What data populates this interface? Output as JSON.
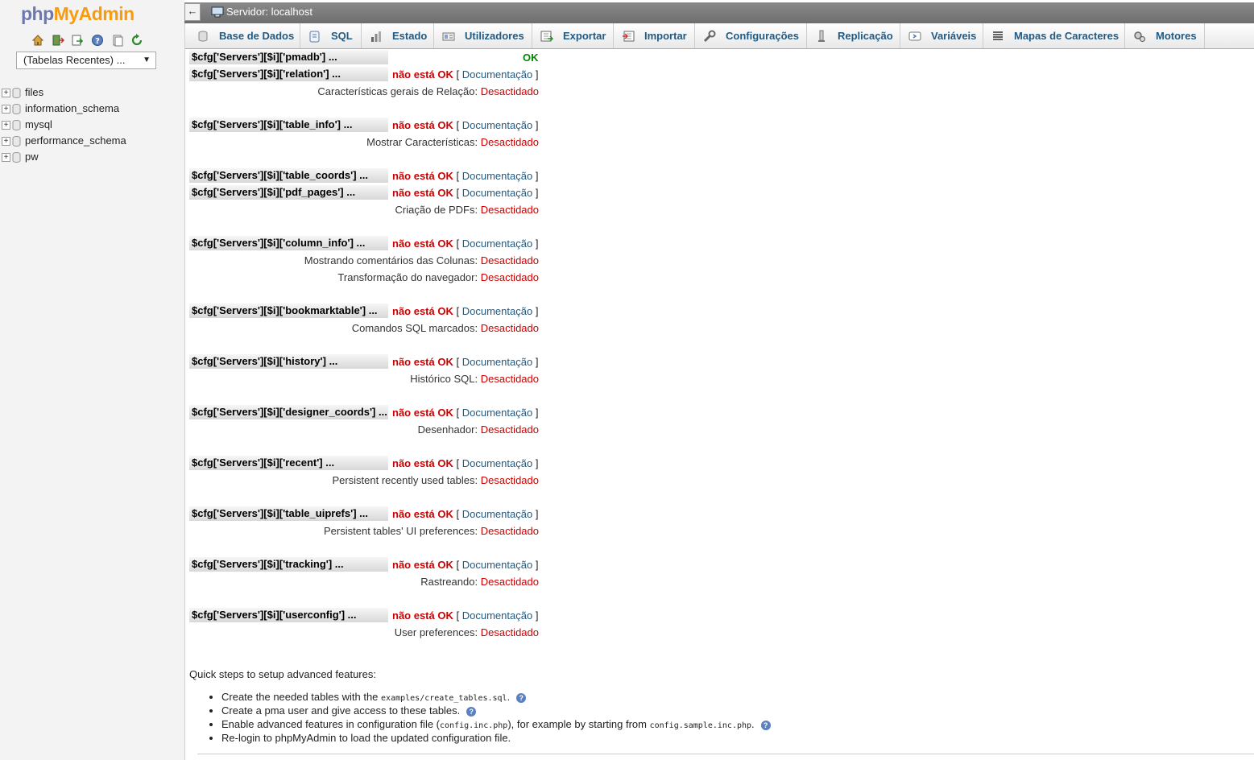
{
  "sidebar": {
    "logo_php": "php",
    "logo_myadmin": "MyAdmin",
    "quick_icons": [
      "home-icon",
      "logout-icon",
      "sql-query-icon",
      "help-icon",
      "documentation-icon",
      "reload-icon"
    ],
    "recent_tables": "(Tabelas Recentes) ...",
    "databases": [
      "files",
      "information_schema",
      "mysql",
      "performance_schema",
      "pw"
    ]
  },
  "header": {
    "back": "←",
    "server": "Servidor: localhost"
  },
  "tabs": [
    {
      "label": "Base de Dados",
      "icon": "database-icon"
    },
    {
      "label": "SQL",
      "icon": "sql-icon"
    },
    {
      "label": "Estado",
      "icon": "status-icon"
    },
    {
      "label": "Utilizadores",
      "icon": "users-icon"
    },
    {
      "label": "Exportar",
      "icon": "export-icon"
    },
    {
      "label": "Importar",
      "icon": "import-icon"
    },
    {
      "label": "Configurações",
      "icon": "wrench-icon"
    },
    {
      "label": "Replicação",
      "icon": "replication-icon"
    },
    {
      "label": "Variáveis",
      "icon": "variables-icon"
    },
    {
      "label": "Mapas de Caracteres",
      "icon": "charset-icon"
    },
    {
      "label": "Motores",
      "icon": "engines-icon"
    }
  ],
  "labels": {
    "ok": "OK",
    "not_ok": "não está OK",
    "doc_open": "[",
    "doc": "Documentação",
    "doc_close": "]",
    "disabled": "Desactidado"
  },
  "config_blocks": [
    {
      "rows": [
        {
          "key": "$cfg['Servers'][$i]['pmadb'] ...",
          "status": "ok"
        },
        {
          "key": "$cfg['Servers'][$i]['relation'] ...",
          "status": "not_ok"
        }
      ],
      "features": [
        "Características gerais de Relação:"
      ]
    },
    {
      "rows": [
        {
          "key": "$cfg['Servers'][$i]['table_info'] ...",
          "status": "not_ok"
        }
      ],
      "features": [
        "Mostrar Características:"
      ]
    },
    {
      "rows": [
        {
          "key": "$cfg['Servers'][$i]['table_coords'] ...",
          "status": "not_ok"
        },
        {
          "key": "$cfg['Servers'][$i]['pdf_pages'] ...",
          "status": "not_ok"
        }
      ],
      "features": [
        "Criação de PDFs:"
      ]
    },
    {
      "rows": [
        {
          "key": "$cfg['Servers'][$i]['column_info'] ...",
          "status": "not_ok"
        }
      ],
      "features": [
        "Mostrando comentários das Colunas:",
        "Transformação do navegador:"
      ]
    },
    {
      "rows": [
        {
          "key": "$cfg['Servers'][$i]['bookmarktable'] ...",
          "status": "not_ok"
        }
      ],
      "features": [
        "Comandos SQL marcados:"
      ]
    },
    {
      "rows": [
        {
          "key": "$cfg['Servers'][$i]['history'] ...",
          "status": "not_ok"
        }
      ],
      "features": [
        "Histórico SQL:"
      ]
    },
    {
      "rows": [
        {
          "key": "$cfg['Servers'][$i]['designer_coords'] ...",
          "status": "not_ok"
        }
      ],
      "features": [
        "Desenhador:"
      ]
    },
    {
      "rows": [
        {
          "key": "$cfg['Servers'][$i]['recent'] ...",
          "status": "not_ok"
        }
      ],
      "features": [
        "Persistent recently used tables:"
      ]
    },
    {
      "rows": [
        {
          "key": "$cfg['Servers'][$i]['table_uiprefs'] ...",
          "status": "not_ok"
        }
      ],
      "features": [
        "Persistent tables' UI preferences:"
      ]
    },
    {
      "rows": [
        {
          "key": "$cfg['Servers'][$i]['tracking'] ...",
          "status": "not_ok"
        }
      ],
      "features": [
        "Rastreando:"
      ]
    },
    {
      "rows": [
        {
          "key": "$cfg['Servers'][$i]['userconfig'] ...",
          "status": "not_ok"
        }
      ],
      "features": [
        "User preferences:"
      ]
    }
  ],
  "quick_steps": {
    "title": "Quick steps to setup advanced features:",
    "step1_pre": "Create the needed tables with the ",
    "step1_code": "examples/create_tables.sql",
    "step1_post": ".",
    "step2": "Create a pma user and give access to these tables.",
    "step3_pre": "Enable advanced features in configuration file (",
    "step3_code1": "config.inc.php",
    "step3_mid": "), for example by starting from ",
    "step3_code2": "config.sample.inc.php",
    "step3_post": ".",
    "step4": "Re-login to phpMyAdmin to load the updated configuration file.",
    "help_glyph": "?"
  }
}
